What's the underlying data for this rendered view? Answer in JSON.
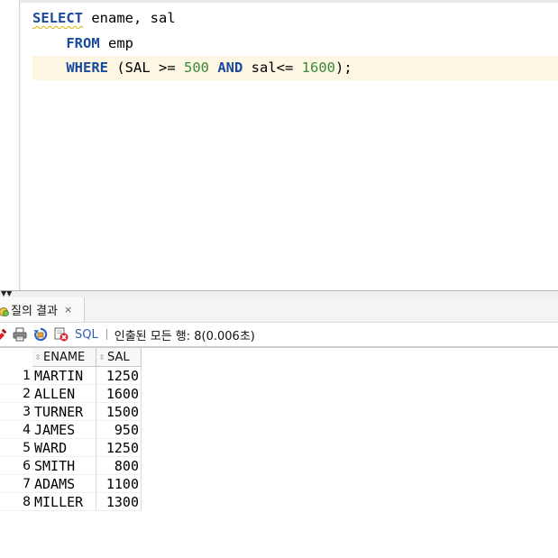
{
  "editor": {
    "lines": [
      {
        "kw1": "SELECT",
        "rest": " ename, sal"
      },
      {
        "indent": "    ",
        "kw1": "FROM",
        "rest": " emp"
      },
      {
        "indent": "    ",
        "kw1": "WHERE",
        "p1": " (SAL >= ",
        "n1": "500",
        "p2": " ",
        "kw2": "AND",
        "p3": " sal<= ",
        "n2": "1600",
        "p4": ");"
      }
    ]
  },
  "results": {
    "tab_label": "질의 결과",
    "tab_close": "×",
    "toolbar": {
      "sql_label": "SQL",
      "status": "인출된 모든 행: 8(0.006초)"
    },
    "columns": [
      {
        "name": "ENAME"
      },
      {
        "name": "SAL"
      }
    ],
    "rows": [
      {
        "num": "1",
        "ename": "MARTIN",
        "sal": "1250"
      },
      {
        "num": "2",
        "ename": "ALLEN",
        "sal": "1600"
      },
      {
        "num": "3",
        "ename": "TURNER",
        "sal": "1500"
      },
      {
        "num": "4",
        "ename": "JAMES",
        "sal": "950"
      },
      {
        "num": "5",
        "ename": "WARD",
        "sal": "1250"
      },
      {
        "num": "6",
        "ename": "SMITH",
        "sal": "800"
      },
      {
        "num": "7",
        "ename": "ADAMS",
        "sal": "1100"
      },
      {
        "num": "8",
        "ename": "MILLER",
        "sal": "1300"
      }
    ]
  },
  "icons": {
    "pin": "pin-icon",
    "print": "print-icon",
    "refresh": "refresh-icon",
    "clear": "clear-results-icon",
    "tab": "query-result-tab-icon",
    "sort": "sort-icon",
    "splitter": "splitter-arrows-icon"
  },
  "colors": {
    "keyword": "#1a4a9c",
    "number": "#3a8a3a",
    "current_line": "#fdf6e3",
    "sql_link": "#2e5fb5"
  }
}
